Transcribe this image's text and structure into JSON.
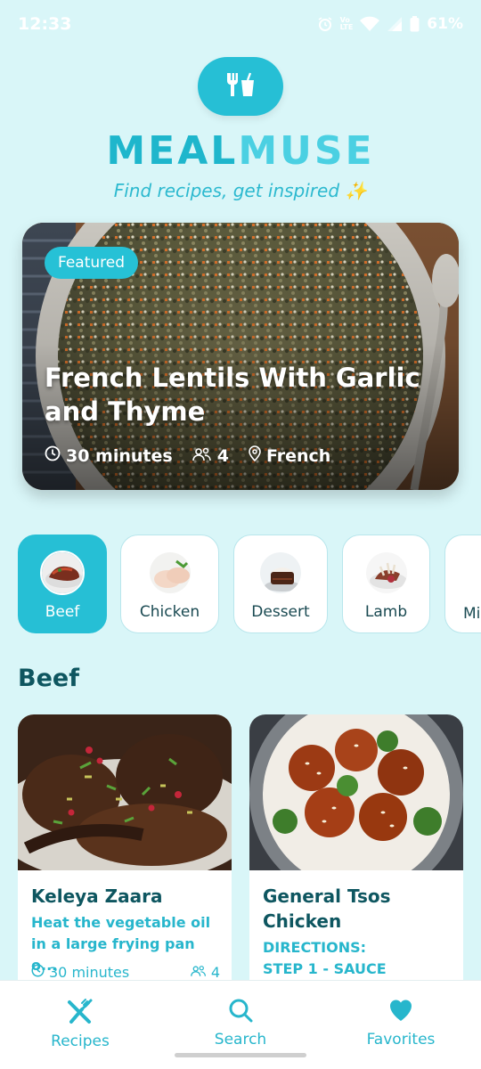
{
  "status_bar": {
    "time": "12:33",
    "battery": "61%"
  },
  "header": {
    "logo_icon": "utensils-icon",
    "title_part1": "MEAL",
    "title_part2": "MUSE",
    "tagline": "Find recipes, get inspired ✨"
  },
  "featured": {
    "badge": "Featured",
    "title": "French Lentils With Garlic and Thyme",
    "time": "30 minutes",
    "servings": "4",
    "cuisine": "French"
  },
  "categories": [
    {
      "label": "Beef",
      "active": true
    },
    {
      "label": "Chicken",
      "active": false
    },
    {
      "label": "Dessert",
      "active": false
    },
    {
      "label": "Lamb",
      "active": false
    },
    {
      "label": "Mi",
      "active": false
    }
  ],
  "section": {
    "title": "Beef"
  },
  "recipes": [
    {
      "name": "Keleya Zaara",
      "description": "Heat the vegetable oil in a large frying pan o...",
      "time": "30 minutes",
      "servings": "4"
    },
    {
      "name": "General Tsos Chicken",
      "description": "DIRECTIONS: STEP 1 - SAUCE ..."
    }
  ],
  "nav": {
    "recipes": "Recipes",
    "search": "Search",
    "favorites": "Favorites"
  },
  "colors": {
    "accent": "#26bfd5",
    "dark": "#0e5660",
    "background": "#d9f6f8"
  }
}
